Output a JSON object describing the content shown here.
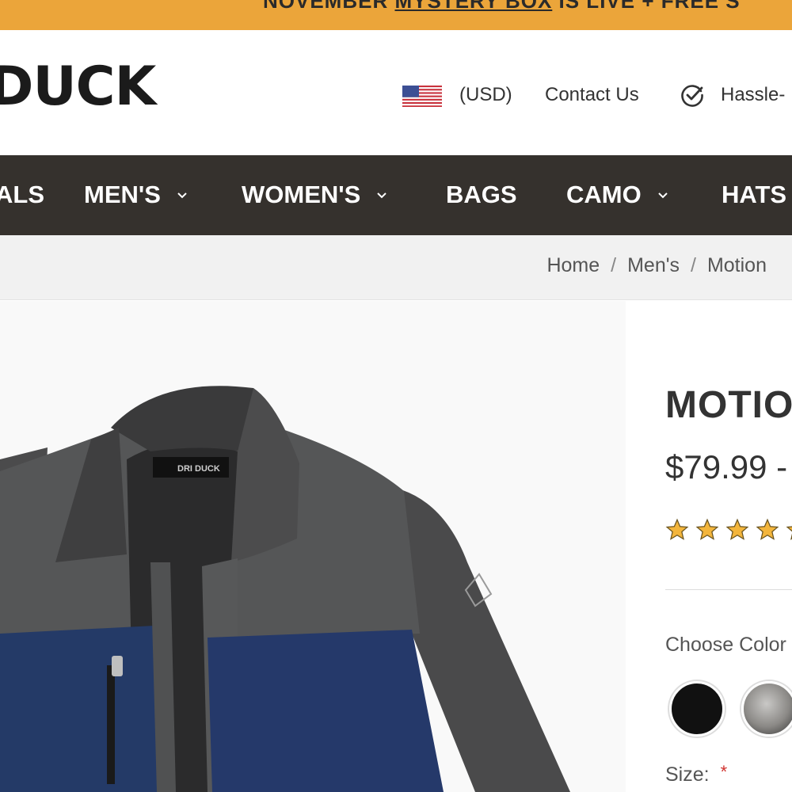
{
  "promo": {
    "prefix": "NOVEMBER ",
    "link": "MYSTERY BOX",
    "suffix": " IS LIVE + FREE S"
  },
  "header": {
    "logo": "DUCK",
    "currency": "(USD)",
    "contact": "Contact Us",
    "hassle": "Hassle-"
  },
  "nav": {
    "items": [
      {
        "label": "ALS"
      },
      {
        "label": "MEN'S"
      },
      {
        "label": "WOMEN'S"
      },
      {
        "label": "BAGS"
      },
      {
        "label": "CAMO"
      },
      {
        "label": "HATS"
      }
    ]
  },
  "breadcrumb": {
    "items": [
      "Home",
      "Men's",
      "Motion"
    ],
    "separator": "/"
  },
  "product": {
    "title": "MOTIO",
    "price": "$79.99 -",
    "rating_stars": 5,
    "choose_color_label": "Choose Color",
    "size_label": "Size:",
    "required_mark": "*",
    "jacket_label": "DRI DUCK"
  },
  "colors": {
    "promo_bg": "#eba53a",
    "nav_bg": "#35312d",
    "star": "#f3b53b"
  },
  "icons": {
    "check": "check-circle-icon",
    "flag": "us-flag-icon",
    "chevron": "chevron-down-icon",
    "star": "star-icon"
  }
}
